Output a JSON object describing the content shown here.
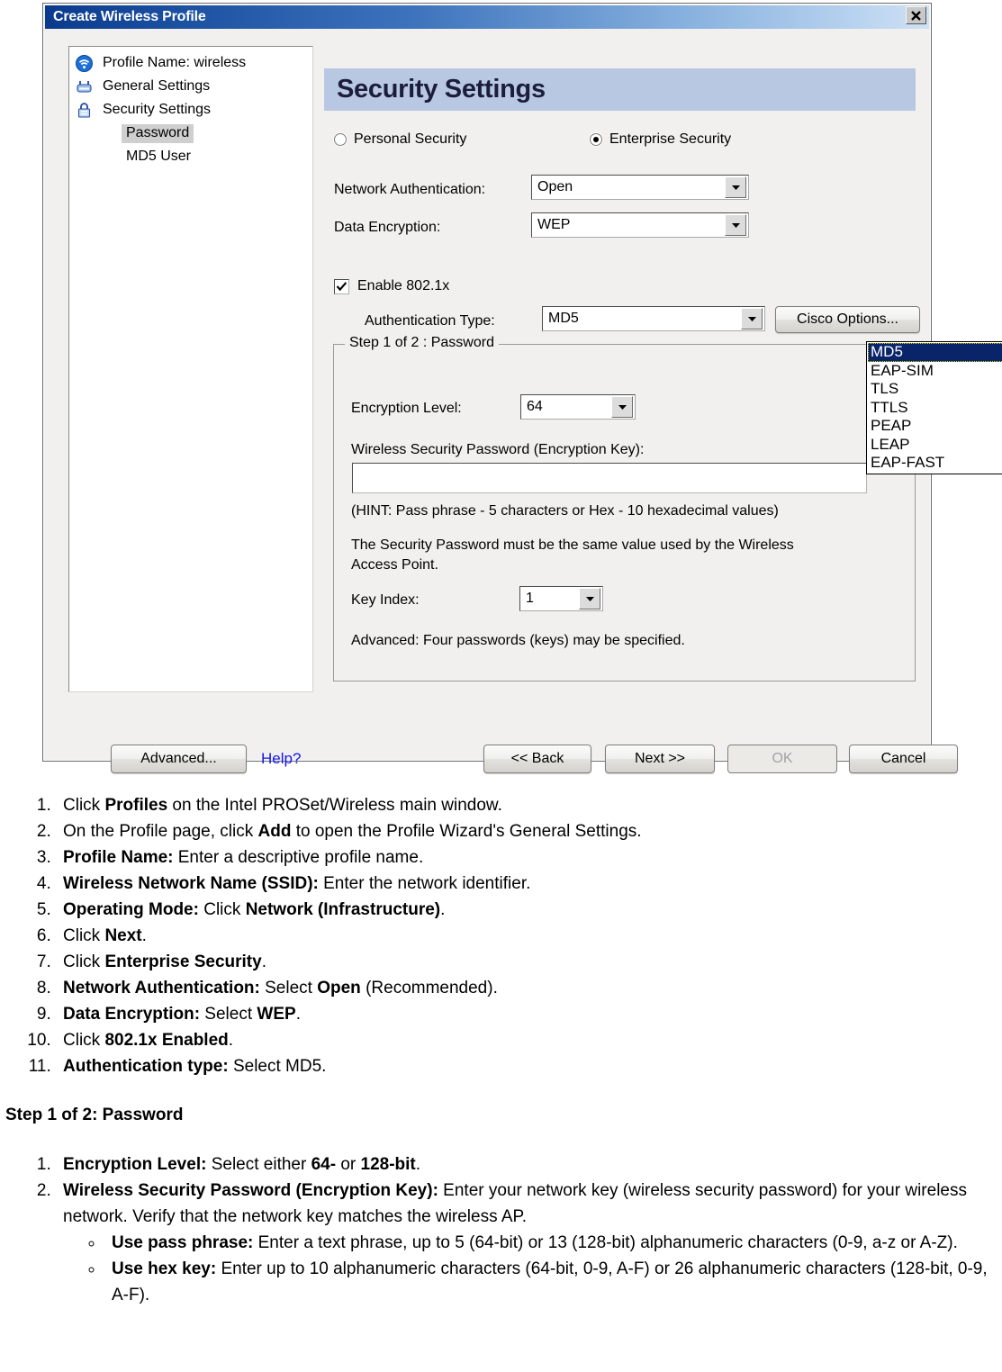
{
  "dialog": {
    "title": "Create Wireless Profile",
    "close_label": "Close",
    "tree": {
      "items": [
        {
          "label": "Profile Name: wireless",
          "icon": "wireless-signal-icon",
          "level": 0,
          "selected": false
        },
        {
          "label": "General Settings",
          "icon": "access-point-icon",
          "level": 0,
          "selected": false
        },
        {
          "label": "Security Settings",
          "icon": "padlock-icon",
          "level": 0,
          "selected": false
        },
        {
          "label": "Password",
          "icon": "",
          "level": 1,
          "selected": true
        },
        {
          "label": "MD5 User",
          "icon": "",
          "level": 1,
          "selected": false
        }
      ]
    },
    "page_title": "Security Settings",
    "security_mode": {
      "personal_label": "Personal Security",
      "personal_selected": false,
      "enterprise_label": "Enterprise Security",
      "enterprise_selected": true
    },
    "network_authentication": {
      "label": "Network Authentication:",
      "value": "Open"
    },
    "data_encryption": {
      "label": "Data Encryption:",
      "value": "WEP"
    },
    "enable_8021x": {
      "label": "Enable 802.1x",
      "checked": true
    },
    "authentication_type": {
      "label": "Authentication Type:",
      "value": "MD5",
      "open": true,
      "options": [
        "MD5",
        "EAP-SIM",
        "TLS",
        "TTLS",
        "PEAP",
        "LEAP",
        "EAP-FAST"
      ],
      "selected_option": "MD5"
    },
    "cisco_options_button": "Cisco Options...",
    "group": {
      "title": "Step 1 of 2 : Password",
      "encryption_level_label": "Encryption Level:",
      "encryption_level_value": "64",
      "password_label": "Wireless Security Password (Encryption Key):",
      "password_value": "",
      "hint": "(HINT: Pass phrase - 5 characters or Hex - 10 hexadecimal values)",
      "note_line1": "The Security Password must be the same value used by the Wireless",
      "note_line2": "Access Point.",
      "key_index_label": "Key Index:",
      "key_index_value": "1",
      "advanced_note": "Advanced: Four passwords (keys) may be specified."
    },
    "buttons": {
      "advanced": "Advanced...",
      "help": "Help?",
      "back": "<< Back",
      "next": "Next >>",
      "ok": "OK",
      "ok_disabled": true,
      "cancel": "Cancel"
    }
  },
  "doc": {
    "steps": [
      "Click <b>Profiles</b> on the Intel PROSet/Wireless main window.",
      "On the Profile page, click <b>Add</b> to open the Profile Wizard's General Settings.",
      "<b>Profile Name:</b> Enter a descriptive profile name.",
      "<b>Wireless Network Name (SSID):</b> Enter the network identifier.",
      "<b>Operating Mode:</b> Click <b>Network (Infrastructure)</b>.",
      "Click <b>Next</b>.",
      "Click <b>Enterprise Security</b>.",
      "<b>Network Authentication:</b> Select <b>Open</b> (Recommended).",
      "<b>Data Encryption:</b> Select <b>WEP</b>.",
      "Click <b>802.1x Enabled</b>.",
      "<b>Authentication type:</b> Select MD5."
    ],
    "section_title": "Step 1 of 2: Password",
    "substeps": [
      "<b>Encryption Level:</b> Select either <b>64-</b> or <b>128-bit</b>.",
      "<b>Wireless Security Password (Encryption Key):</b> Enter your network key (wireless security password) for your wireless network. Verify that the network key matches the wireless AP."
    ],
    "bullets": [
      "<b>Use pass phrase:</b> Enter a text phrase, up to 5 (64-bit) or 13 (128-bit) alphanumeric characters (0-9, a-z or A-Z).",
      "<b>Use hex key:</b> Enter up to 10 alphanumeric characters (64-bit, 0-9, A-F) or 26 alphanumeric characters (128-bit, 0-9, A-F)."
    ]
  }
}
